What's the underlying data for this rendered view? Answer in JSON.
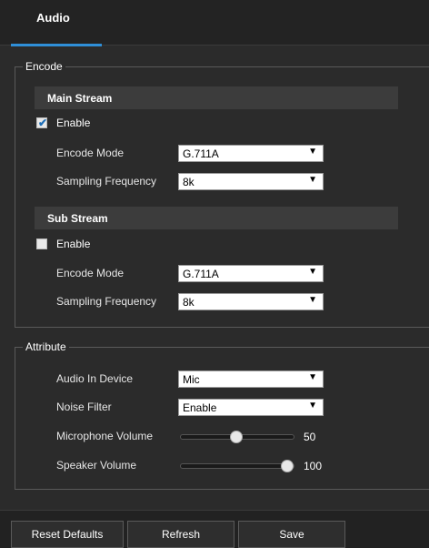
{
  "tabs": [
    {
      "label": "Audio",
      "active": true
    }
  ],
  "encode": {
    "legend": "Encode",
    "main_stream": {
      "title": "Main Stream",
      "enable_label": "Enable",
      "enabled": true,
      "encode_mode_label": "Encode Mode",
      "encode_mode_value": "G.711A",
      "sampling_label": "Sampling Frequency",
      "sampling_value": "8k"
    },
    "sub_stream": {
      "title": "Sub Stream",
      "enable_label": "Enable",
      "enabled": false,
      "encode_mode_label": "Encode Mode",
      "encode_mode_value": "G.711A",
      "sampling_label": "Sampling Frequency",
      "sampling_value": "8k"
    }
  },
  "attribute": {
    "legend": "Attribute",
    "audio_in_device_label": "Audio In Device",
    "audio_in_device_value": "Mic",
    "noise_filter_label": "Noise Filter",
    "noise_filter_value": "Enable",
    "microphone_volume_label": "Microphone Volume",
    "microphone_volume_value": "50",
    "speaker_volume_label": "Speaker Volume",
    "speaker_volume_value": "100"
  },
  "buttons": {
    "reset_defaults": "Reset Defaults",
    "refresh": "Refresh",
    "save": "Save"
  },
  "icons": {
    "check": "check-icon",
    "dropdown": "chevron-down-icon"
  },
  "colors": {
    "accent": "#2f8fd8",
    "background": "#2b2b2b"
  }
}
